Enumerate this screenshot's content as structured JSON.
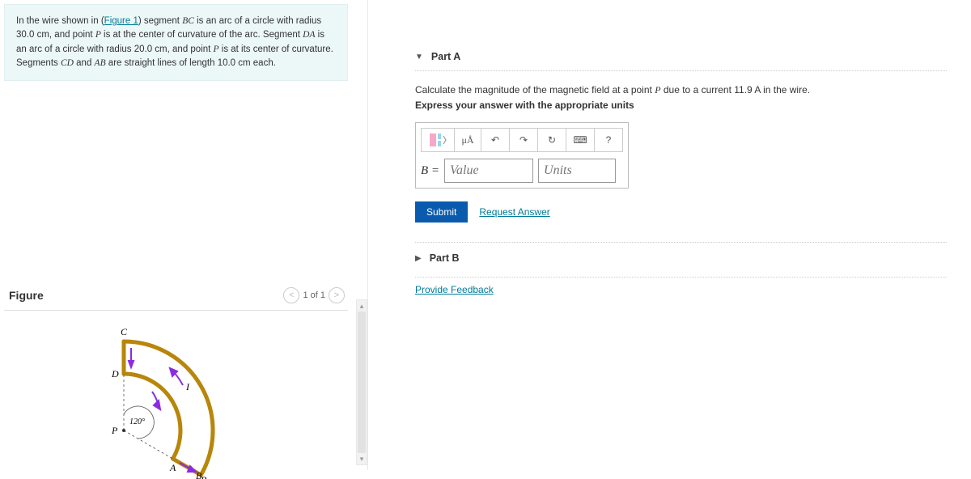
{
  "prompt": {
    "intro_pre": "In the wire shown in (",
    "figure_link": "Figure 1",
    "intro_post": ") segment ",
    "seg_bc": "BC",
    "txt1": " is an arc of a circle with radius 30.0 cm, and point ",
    "pt_p": "P",
    "txt2": " is at the center of curvature of the arc. Segment ",
    "seg_da": "DA",
    "txt3": " is an arc of a circle with radius 20.0 cm, and point ",
    "pt_p2": "P",
    "txt4": " is at its center of curvature. Segments ",
    "seg_cd": "CD",
    "txt5": " and ",
    "seg_ab": "AB",
    "txt6": " are straight lines of length 10.0 cm each."
  },
  "figure": {
    "title": "Figure",
    "pager_prev": "<",
    "pager_text": "1 of 1",
    "pager_next": ">",
    "labels": {
      "c": "C",
      "d": "D",
      "p": "P",
      "a": "A",
      "b": "B",
      "i": "I",
      "angle": "120°"
    }
  },
  "parts": {
    "a": {
      "title": "Part A",
      "question_pre": "Calculate the magnitude of the magnetic field at a point ",
      "question_var": "P",
      "question_mid": " due to a current 11.9 ",
      "question_unit": "A",
      "question_post": " in the wire.",
      "instruct": "Express your answer with the appropriate units",
      "tool_units": "μÅ",
      "tool_undo": "↶",
      "tool_redo": "↷",
      "tool_reset": "↻",
      "tool_keyboard": "⌨",
      "tool_help": "?",
      "var_label": "B =",
      "value_placeholder": "Value",
      "units_placeholder": "Units",
      "submit": "Submit",
      "request": "Request Answer"
    },
    "b": {
      "title": "Part B"
    }
  },
  "feedback": {
    "link": "Provide Feedback"
  }
}
